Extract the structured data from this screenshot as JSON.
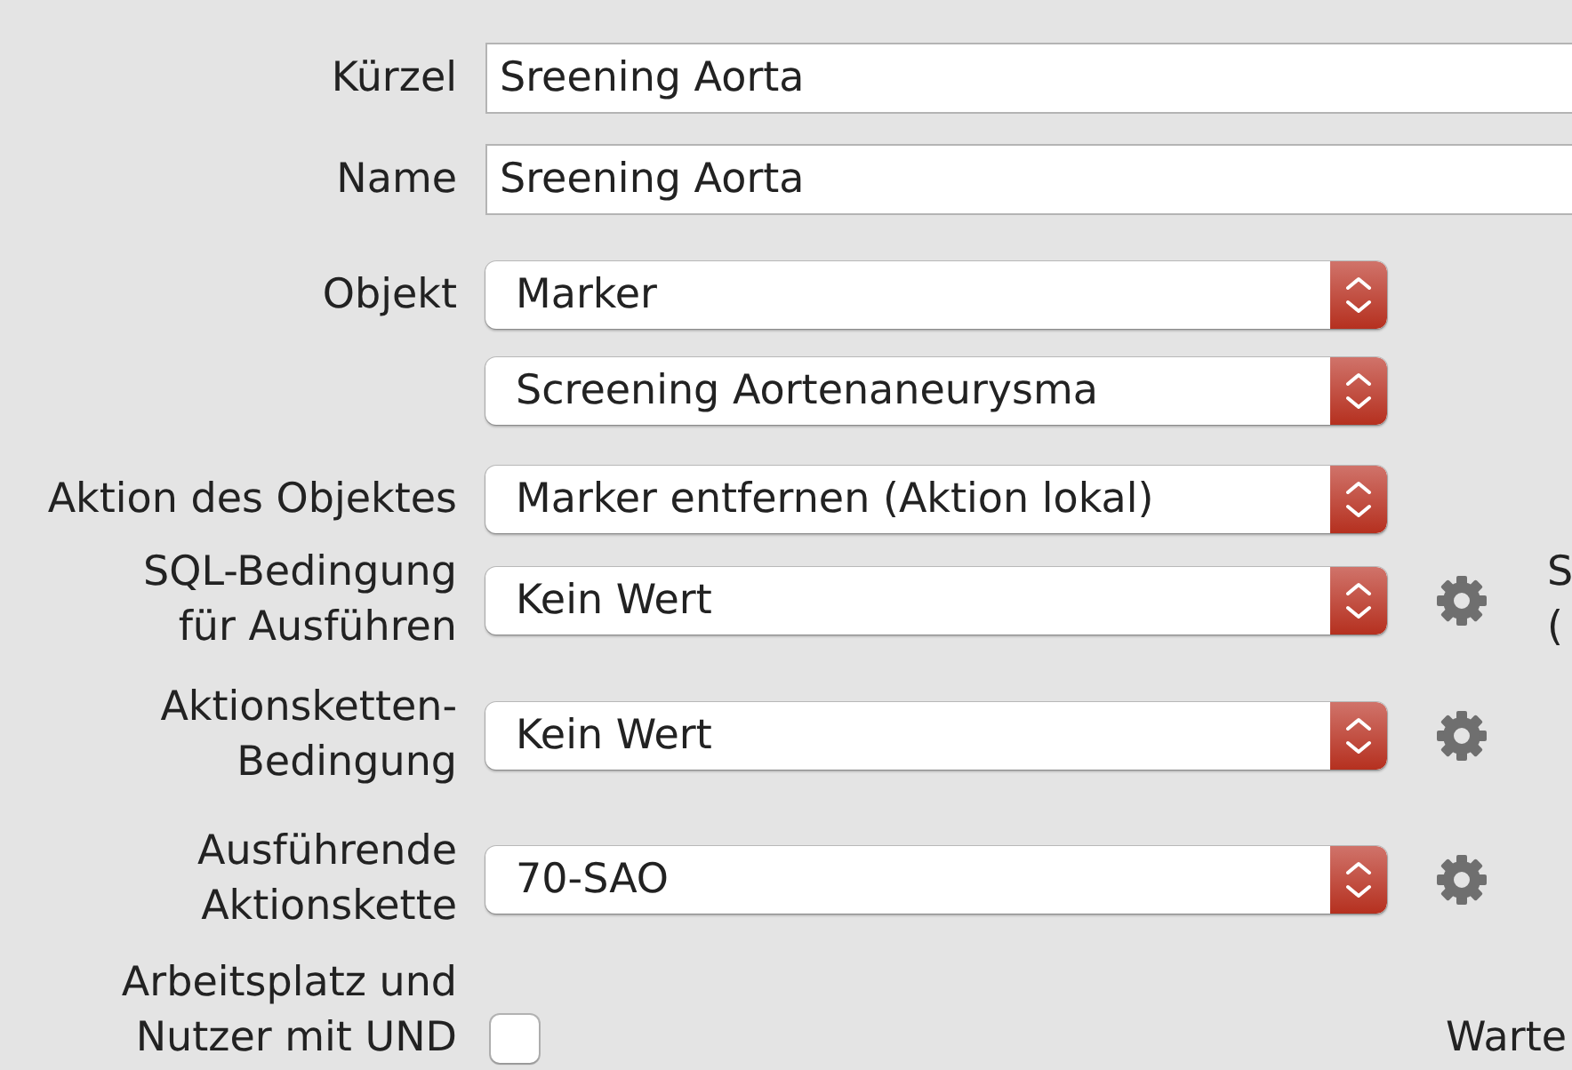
{
  "fields": [
    {
      "kind": "text",
      "label_lines": [
        "Kürzel"
      ],
      "value": "Sreening Aorta"
    },
    {
      "kind": "text",
      "label_lines": [
        "Name"
      ],
      "value": "Sreening Aorta"
    },
    {
      "kind": "select",
      "label_lines": [
        "Objekt"
      ],
      "value": "Marker",
      "gear": false
    },
    {
      "kind": "select",
      "value": "Screening Aortenaneurysma",
      "gear": false
    },
    {
      "kind": "select",
      "label_lines": [
        "Aktion des Objektes"
      ],
      "value": "Marker entfernen (Aktion lokal)",
      "gear": false
    },
    {
      "kind": "select",
      "label_lines": [
        "SQL-Bedingung",
        "für Ausführen"
      ],
      "value": "Kein Wert",
      "gear": true,
      "side_lines": [
        "S",
        "("
      ]
    },
    {
      "kind": "select",
      "label_lines": [
        "Aktionsketten-",
        "Bedingung"
      ],
      "value": "Kein Wert",
      "gear": true
    },
    {
      "kind": "select",
      "label_lines": [
        "Ausführende",
        "Aktionskette"
      ],
      "value": "70-SAO",
      "gear": true
    },
    {
      "kind": "checkbox",
      "label_lines": [
        "Arbeitsplatz und",
        "Nutzer mit UND"
      ],
      "checked": false,
      "side_lines": [
        "Warte"
      ]
    }
  ]
}
